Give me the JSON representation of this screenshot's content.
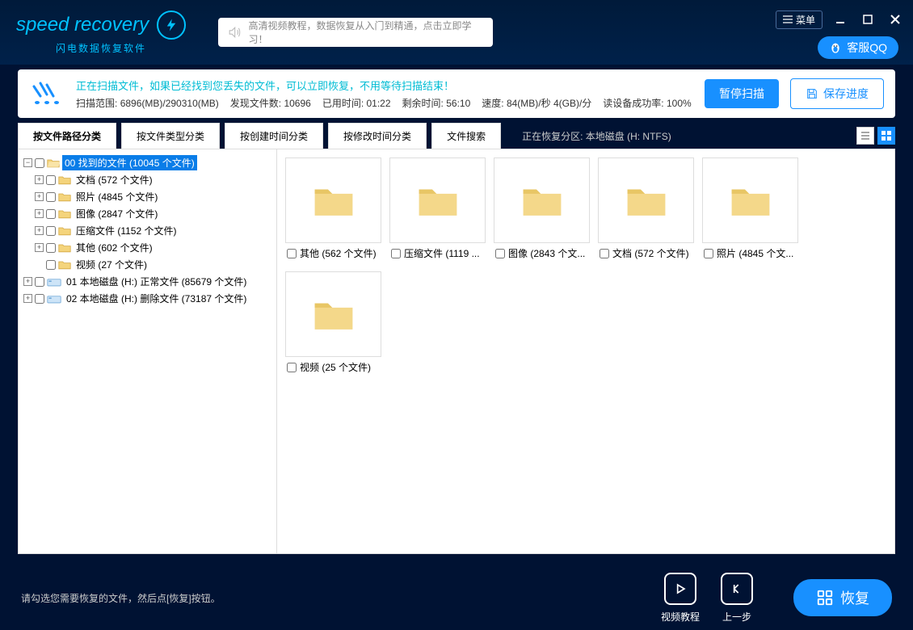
{
  "titleBar": {
    "logo": "speed recovery",
    "logoSub": "闪电数据恢复软件",
    "tutorialText": "高清视频教程，数据恢复从入门到精通，点击立即学习！",
    "menuLabel": "菜单",
    "qqLabel": "客服QQ"
  },
  "statusPanel": {
    "line1": "正在扫描文件，如果已经找到您丢失的文件，可以立即恢复，不用等待扫描结束！",
    "scanRangeLabel": "扫描范围:",
    "scanRangeValue": "6896(MB)/290310(MB)",
    "foundLabel": "发现文件数:",
    "foundValue": "10696",
    "elapsedLabel": "已用时间:",
    "elapsedValue": "01:22",
    "remainingLabel": "剩余时间:",
    "remainingValue": "56:10",
    "speedLabel": "速度:",
    "speedValue": "84(MB)/秒 4(GB)/分",
    "readRateLabel": "读设备成功率:",
    "readRateValue": "100%",
    "pauseBtn": "暂停扫描",
    "saveBtn": "保存进度"
  },
  "tabs": {
    "tab1": "按文件路径分类",
    "tab2": "按文件类型分类",
    "tab3": "按创建时间分类",
    "tab4": "按修改时间分类",
    "tab5": "文件搜索",
    "partitionInfo": "正在恢复分区: 本地磁盘 (H: NTFS)"
  },
  "tree": {
    "root": "00 找到的文件   (10045 个文件)",
    "children": [
      "文档    (572 个文件)",
      "照片    (4845 个文件)",
      "图像    (2847 个文件)",
      "压缩文件    (1152 个文件)",
      "其他    (602 个文件)",
      "视频    (27 个文件)"
    ],
    "drive1": "01 本地磁盘 (H:) 正常文件   (85679 个文件)",
    "drive2": "02 本地磁盘 (H:) 删除文件   (73187 个文件)"
  },
  "gridItems": [
    "其他  (562 个文件)",
    "压缩文件  (1119 ...",
    "图像  (2843 个文...",
    "文档  (572 个文件)",
    "照片  (4845 个文...",
    "视频  (25 个文件)"
  ],
  "footer": {
    "hint": "请勾选您需要恢复的文件，然后点[恢复]按钮。",
    "videoTutorial": "视频教程",
    "prevStep": "上一步",
    "recoverBtn": "恢复"
  }
}
